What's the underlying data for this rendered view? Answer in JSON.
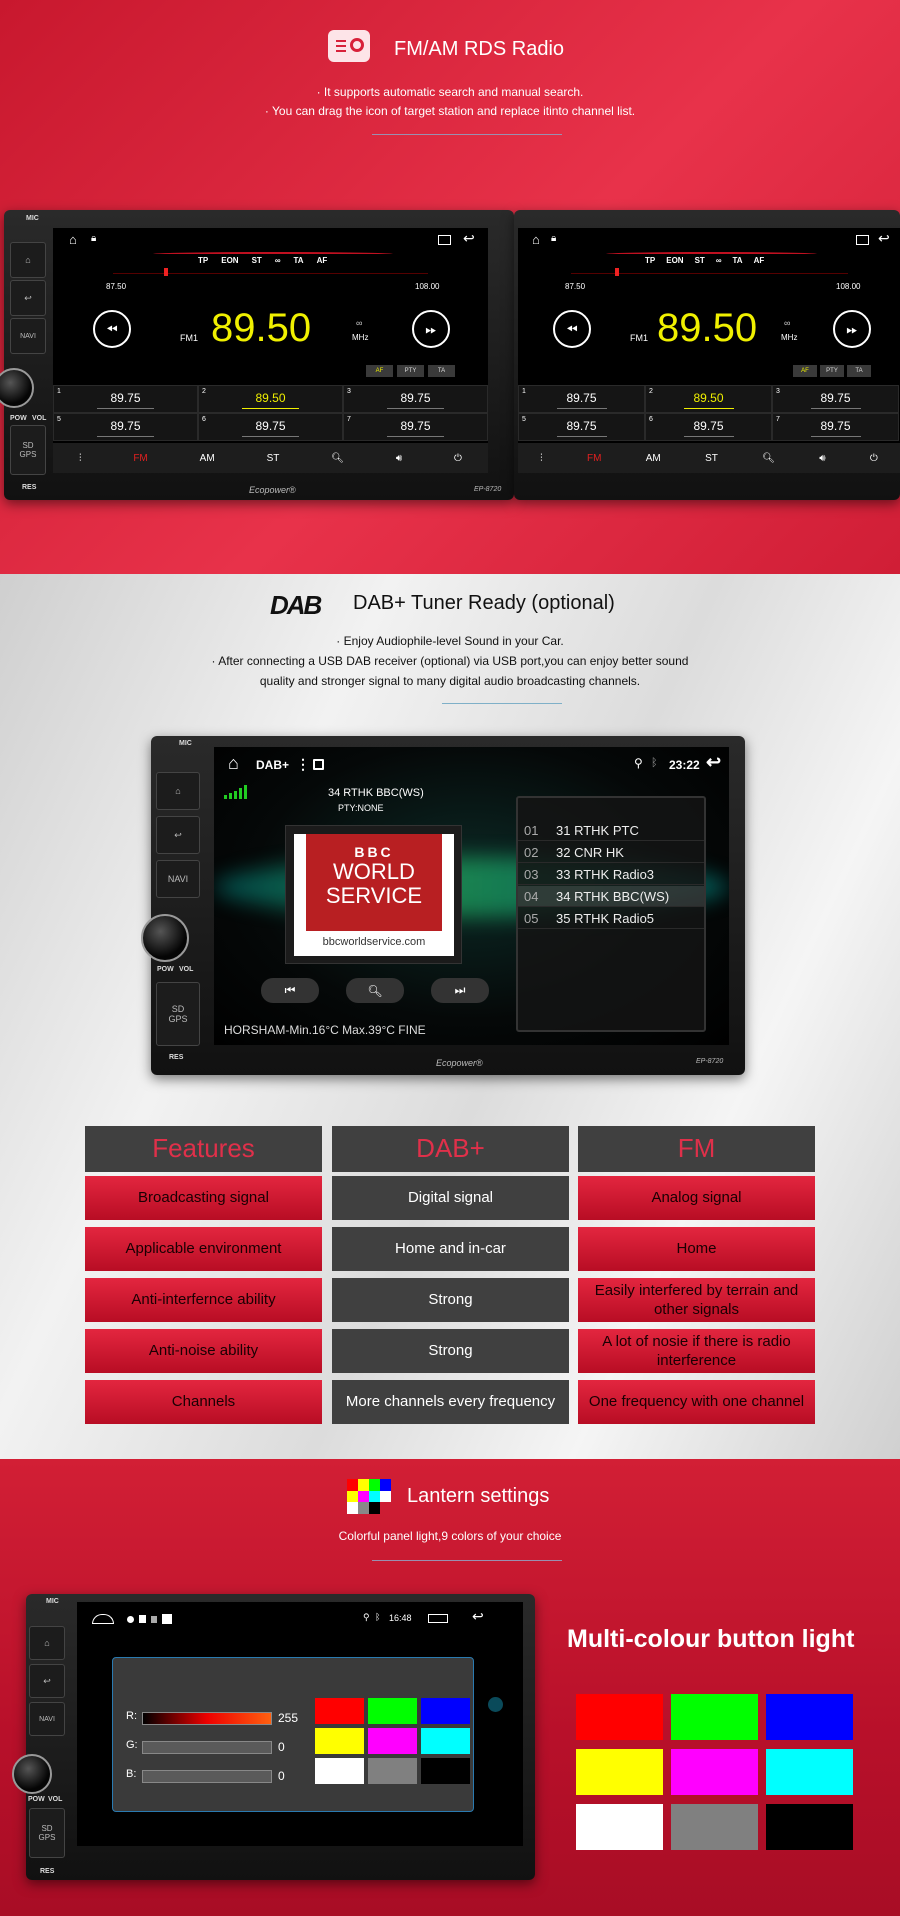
{
  "fm_section": {
    "title": "FM/AM RDS Radio",
    "icon": "radio-icon",
    "bullets": [
      "· It supports automatic search and manual search.",
      "· You can drag the icon of target station and replace itinto channel list."
    ]
  },
  "radio": {
    "tags": [
      "TP",
      "EON",
      "ST",
      "∞",
      "TA",
      "AF"
    ],
    "range_min": "87.50",
    "range_max": "108.00",
    "band": "FM1",
    "frequency": "89.50",
    "unit": "MHz",
    "buttons": [
      "AF",
      "PTY",
      "TA"
    ],
    "presets": [
      {
        "n": "1",
        "f": "89.75"
      },
      {
        "n": "2",
        "f": "89.50"
      },
      {
        "n": "3",
        "f": "89.75"
      },
      {
        "n": "5",
        "f": "89.75"
      },
      {
        "n": "6",
        "f": "89.75"
      },
      {
        "n": "7",
        "f": "89.75"
      }
    ],
    "bottom": [
      "FM",
      "AM",
      "ST"
    ],
    "active_band": "FM",
    "accent": "#f0f000"
  },
  "unit": {
    "mic": "MIC",
    "navi": "NAVI",
    "pow": "POW",
    "vol": "VOL",
    "sd": "SD",
    "gps": "GPS",
    "res": "RES",
    "brand": "Ecopower®",
    "model": "EP-8720"
  },
  "dab_section": {
    "title": "DAB+ Tuner Ready (optional)",
    "logo": "DAB",
    "bullets": [
      "· Enjoy Audiophile-level Sound in your Car.",
      "· After connecting a USB DAB receiver (optional) via USB port,you can enjoy better sound",
      "quality and stronger signal to many digital audio broadcasting channels."
    ]
  },
  "dab": {
    "app": "DAB+",
    "time": "23:22",
    "station": "34 RTHK BBC(WS)",
    "pty": "PTY:NONE",
    "logo_lines": [
      "BBC",
      "WORLD",
      "SERVICE"
    ],
    "logo_url": "bbcworldservice.com",
    "weather": "HORSHAM-Min.16°C Max.39°C FINE",
    "list": [
      {
        "n": "01",
        "name": "31 RTHK PTC"
      },
      {
        "n": "02",
        "name": "32 CNR HK"
      },
      {
        "n": "03",
        "name": "33 RTHK Radio3"
      },
      {
        "n": "04",
        "name": "34 RTHK BBC(WS)"
      },
      {
        "n": "05",
        "name": "35 RTHK Radio5"
      }
    ],
    "selected_index": 3
  },
  "table": {
    "headers": [
      "Features",
      "DAB+",
      "FM"
    ],
    "rows": [
      [
        "Broadcasting signal",
        "Digital signal",
        "Analog signal"
      ],
      [
        "Applicable environment",
        "Home and in-car",
        "Home"
      ],
      [
        "Anti-interfernce ability",
        "Strong",
        "Easily interfered by terrain and other signals"
      ],
      [
        "Anti-noise ability",
        "Strong",
        "A lot of nosie if there is radio interference"
      ],
      [
        "Channels",
        "More channels every frequency",
        "One frequency with one channel"
      ]
    ]
  },
  "lantern_section": {
    "title": "Lantern settings",
    "subtitle": "Colorful panel light,9 colors of your choice",
    "side_title": "Multi-colour button light"
  },
  "lantern": {
    "time": "16:48",
    "sliders": [
      {
        "label": "R:",
        "value": "255"
      },
      {
        "label": "G:",
        "value": "0"
      },
      {
        "label": "B:",
        "value": "0"
      }
    ],
    "colors": [
      "#ff0000",
      "#00ff00",
      "#0000ff",
      "#ffff00",
      "#ff00ff",
      "#00ffff",
      "#ffffff",
      "#808080",
      "#000000"
    ]
  }
}
